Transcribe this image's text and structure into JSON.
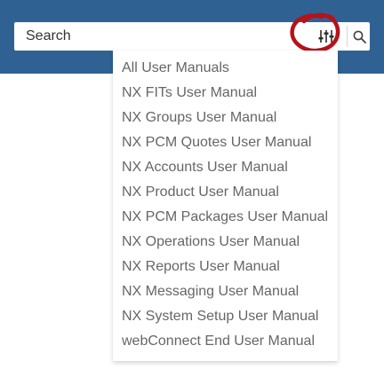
{
  "search": {
    "placeholder": "Search",
    "filter_icon": "sliders-icon",
    "search_icon": "magnifier-icon"
  },
  "annotation": {
    "shape": "hand-drawn circle",
    "color": "#b5121b"
  },
  "colors": {
    "header_background": "#2f6293",
    "menu_text": "#666666"
  },
  "manuals": [
    "All User Manuals",
    "NX FITs User Manual",
    "NX Groups User Manual",
    "NX PCM Quotes User Manual",
    "NX Accounts User Manual",
    "NX Product User Manual",
    "NX PCM Packages User Manual",
    "NX Operations User Manual",
    "NX Reports User Manual",
    "NX Messaging User Manual",
    "NX System Setup User Manual",
    "webConnect End User Manual"
  ]
}
